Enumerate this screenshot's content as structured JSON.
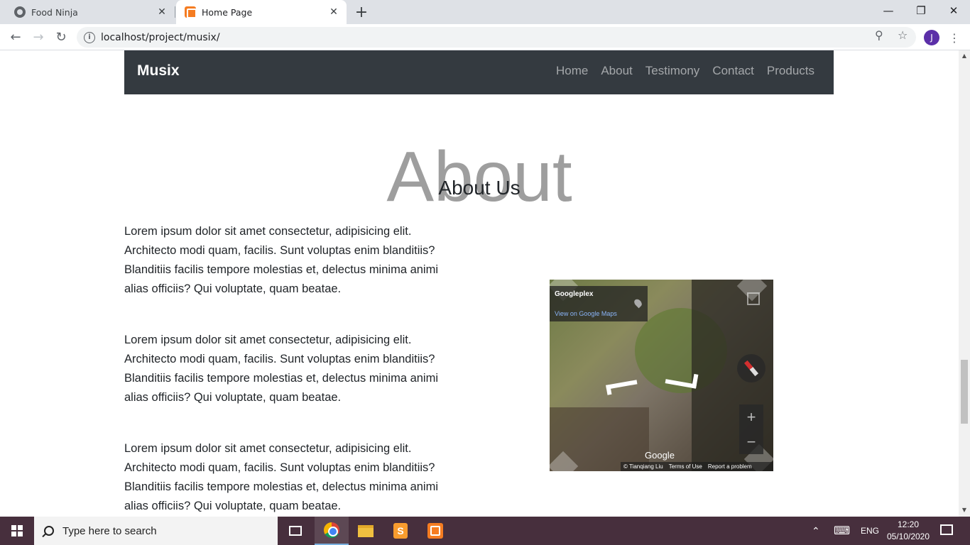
{
  "browser": {
    "tabs": [
      {
        "title": "Food Ninja",
        "active": false
      },
      {
        "title": "Home Page",
        "active": true
      }
    ],
    "url": "localhost/project/musix/",
    "profile_initial": "J"
  },
  "site": {
    "brand": "Musix",
    "nav": [
      "Home",
      "About",
      "Testimony",
      "Contact",
      "Products"
    ],
    "section_bg_title": "About",
    "section_title": "About Us",
    "paragraphs": [
      "Lorem ipsum dolor sit amet consectetur, adipisicing elit. Architecto modi quam, facilis. Sunt voluptas enim blanditiis? Blanditiis facilis tempore molestias et, delectus minima animi alias officiis? Qui voluptate, quam beatae.",
      "Lorem ipsum dolor sit amet consectetur, adipisicing elit. Architecto modi quam, facilis. Sunt voluptas enim blanditiis? Blanditiis facilis tempore molestias et, delectus minima animi alias officiis? Qui voluptate, quam beatae.",
      "Lorem ipsum dolor sit amet consectetur, adipisicing elit. Architecto modi quam, facilis. Sunt voluptas enim blanditiis? Blanditiis facilis tempore molestias et, delectus minima animi alias officiis? Qui voluptate, quam beatae."
    ]
  },
  "streetview": {
    "place": "Googleplex",
    "link": "View on Google Maps",
    "logo": "Google",
    "attribution": "© Tianqiang Liu",
    "terms": "Terms of Use",
    "report": "Report a problem",
    "zoom_in": "+",
    "zoom_out": "−"
  },
  "taskbar": {
    "search_placeholder": "Type here to search",
    "language": "ENG",
    "time": "12:20",
    "date": "05/10/2020"
  },
  "colors": {
    "navbar": "#343a40",
    "taskbar": "#472f3d",
    "background_title": "#9e9e9e"
  }
}
